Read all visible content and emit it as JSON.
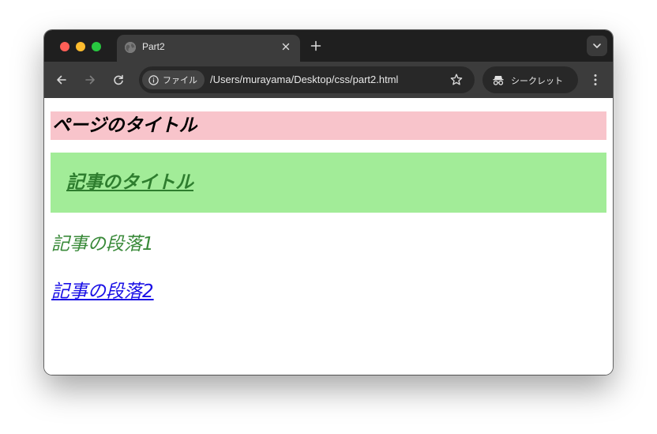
{
  "browser": {
    "tab": {
      "title": "Part2",
      "favicon": "globe-icon",
      "close_icon": "close-icon"
    },
    "new_tab_icon": "plus-icon",
    "tab_search_icon": "chevron-down-icon",
    "toolbar": {
      "back_icon": "arrow-left-icon",
      "forward_icon": "arrow-right-icon",
      "reload_icon": "reload-icon",
      "site_info_label": "ファイル",
      "url": "/Users/murayama/Desktop/css/part2.html",
      "bookmark_icon": "star-icon",
      "incognito_label": "シークレット",
      "menu_icon": "more-vertical-icon"
    }
  },
  "page": {
    "title": "ページのタイトル",
    "article_title": "記事のタイトル",
    "paragraph1": "記事の段落1",
    "paragraph2": "記事の段落2"
  },
  "colors": {
    "tabbar_bg": "#1f1f1f",
    "toolbar_bg": "#3c3c3c",
    "page_title_bg": "#f8c4cb",
    "article_bg": "#a2ec98",
    "article_title_color": "#2e7d2e",
    "paragraph1_color": "#3a8a3a",
    "paragraph2_color": "#1a10e6"
  }
}
